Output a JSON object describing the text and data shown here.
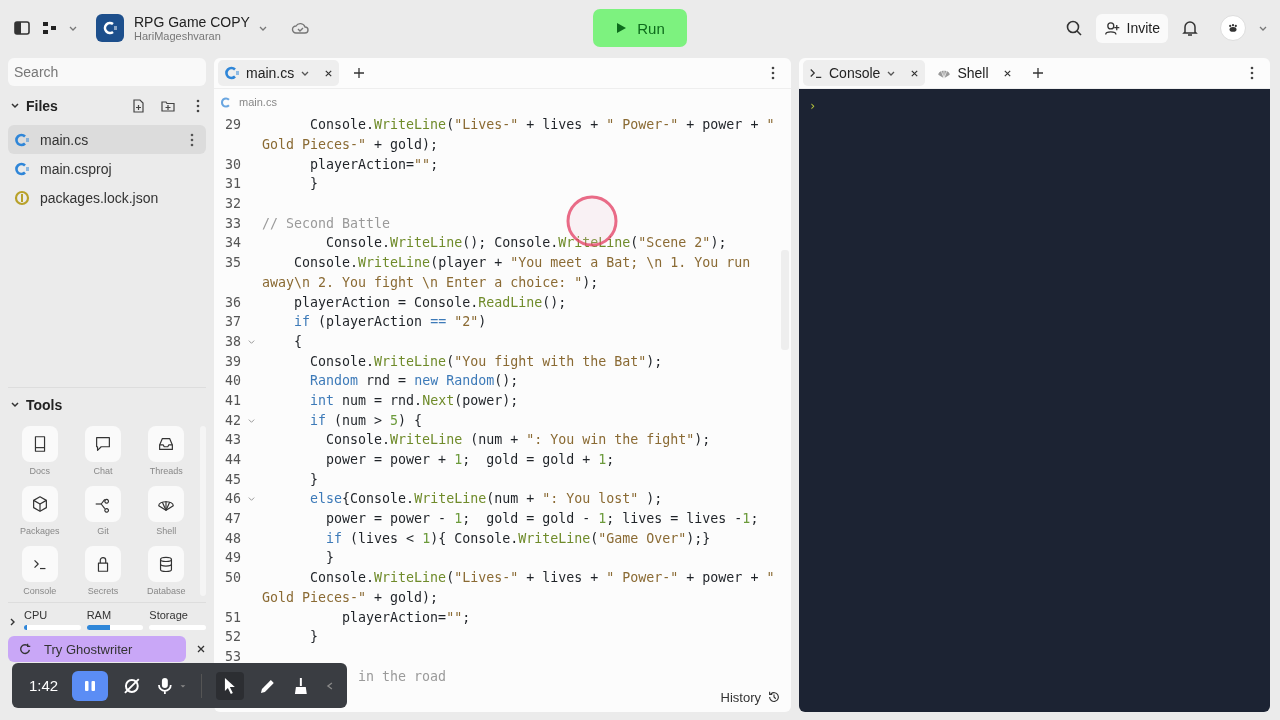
{
  "topbar": {
    "project": "RPG Game COPY",
    "owner": "HariMageshvaran",
    "run": "Run",
    "invite": "Invite"
  },
  "sidebar": {
    "search_placeholder": "Search",
    "files_title": "Files",
    "files": [
      {
        "name": "main.cs",
        "kind": "csharp",
        "selected": true
      },
      {
        "name": "main.csproj",
        "kind": "csharp",
        "selected": false
      },
      {
        "name": "packages.lock.json",
        "kind": "json",
        "selected": false
      }
    ],
    "tools_title": "Tools",
    "tools": [
      {
        "label": "Docs",
        "kind": "docs"
      },
      {
        "label": "Chat",
        "kind": "chat"
      },
      {
        "label": "Threads",
        "kind": "threads"
      },
      {
        "label": "Packages",
        "kind": "packages"
      },
      {
        "label": "Git",
        "kind": "git"
      },
      {
        "label": "Shell",
        "kind": "shell"
      },
      {
        "label": "Console",
        "kind": "console"
      },
      {
        "label": "Secrets",
        "kind": "secrets"
      },
      {
        "label": "Database",
        "kind": "database"
      }
    ],
    "resources": [
      {
        "label": "CPU",
        "level": 0.06
      },
      {
        "label": "RAM",
        "level": 0.42
      },
      {
        "label": "Storage"
      }
    ],
    "ghostwriter": "Try Ghostwriter"
  },
  "editor": {
    "tabs": [
      {
        "label": "main.cs",
        "selected": true
      }
    ],
    "breadcrumb": "main.cs",
    "history": "History",
    "lines": [
      {
        "number": "29",
        "foldable": false,
        "tokens": [
          {
            "kind": "plain",
            "text": "      Console."
          },
          {
            "kind": "method",
            "text": "WriteLine"
          },
          {
            "kind": "plain",
            "text": "("
          },
          {
            "kind": "string",
            "text": "\"Lives-\""
          },
          {
            "kind": "plain",
            "text": " + lives + "
          },
          {
            "kind": "string",
            "text": "\" Power-\""
          },
          {
            "kind": "plain",
            "text": " + power + "
          },
          {
            "kind": "string",
            "text": "\""
          }
        ]
      },
      {
        "foldable": false,
        "tokens": [
          {
            "kind": "string",
            "text": "Gold Pieces-\""
          },
          {
            "kind": "plain",
            "text": " + gold);"
          }
        ]
      },
      {
        "number": "30",
        "foldable": false,
        "tokens": [
          {
            "kind": "plain",
            "text": "      playerAction="
          },
          {
            "kind": "string",
            "text": "\"\""
          },
          {
            "kind": "plain",
            "text": ";"
          }
        ]
      },
      {
        "number": "31",
        "foldable": false,
        "tokens": [
          {
            "kind": "plain",
            "text": "      }"
          }
        ]
      },
      {
        "number": "32",
        "foldable": false
      },
      {
        "number": "33",
        "foldable": false,
        "tokens": [
          {
            "kind": "comment",
            "text": "// Second Battle"
          }
        ]
      },
      {
        "number": "34",
        "foldable": false,
        "tokens": [
          {
            "kind": "plain",
            "text": "        Console."
          },
          {
            "kind": "method",
            "text": "WriteLine"
          },
          {
            "kind": "plain",
            "text": "(); Console."
          },
          {
            "kind": "method",
            "text": "WriteLine"
          },
          {
            "kind": "plain",
            "text": "("
          },
          {
            "kind": "string",
            "text": "\"Scene 2\""
          },
          {
            "kind": "plain",
            "text": ");"
          }
        ]
      },
      {
        "number": "35",
        "foldable": false,
        "tokens": [
          {
            "kind": "plain",
            "text": "    Console."
          },
          {
            "kind": "method",
            "text": "WriteLine"
          },
          {
            "kind": "plain",
            "text": "(player + "
          },
          {
            "kind": "string",
            "text": "\"You meet a Bat; \\n 1. You run"
          }
        ]
      },
      {
        "foldable": false,
        "tokens": [
          {
            "kind": "string",
            "text": "away\\n 2. You fight \\n Enter a choice: \""
          },
          {
            "kind": "plain",
            "text": ");"
          }
        ]
      },
      {
        "number": "36",
        "foldable": false,
        "tokens": [
          {
            "kind": "plain",
            "text": "    playerAction = Console."
          },
          {
            "kind": "method",
            "text": "ReadLine"
          },
          {
            "kind": "plain",
            "text": "();"
          }
        ]
      },
      {
        "number": "37",
        "foldable": false,
        "tokens": [
          {
            "kind": "keyword",
            "text": "    if"
          },
          {
            "kind": "plain",
            "text": " (playerAction "
          },
          {
            "kind": "keyword",
            "text": "== "
          },
          {
            "kind": "string",
            "text": "\"2\""
          },
          {
            "kind": "plain",
            "text": ")"
          }
        ]
      },
      {
        "number": "38",
        "foldable": true,
        "tokens": [
          {
            "kind": "plain",
            "text": "    {"
          }
        ]
      },
      {
        "number": "39",
        "foldable": false,
        "tokens": [
          {
            "kind": "plain",
            "text": "      Console."
          },
          {
            "kind": "method",
            "text": "WriteLine"
          },
          {
            "kind": "plain",
            "text": "("
          },
          {
            "kind": "string",
            "text": "\"You fight with the Bat\""
          },
          {
            "kind": "plain",
            "text": ");"
          }
        ]
      },
      {
        "number": "40",
        "foldable": false,
        "tokens": [
          {
            "kind": "type",
            "text": "      Random"
          },
          {
            "kind": "plain",
            "text": " rnd = "
          },
          {
            "kind": "keyword",
            "text": "new "
          },
          {
            "kind": "type",
            "text": "Random"
          },
          {
            "kind": "plain",
            "text": "();"
          }
        ]
      },
      {
        "number": "41",
        "foldable": false,
        "tokens": [
          {
            "kind": "keyword",
            "text": "      int"
          },
          {
            "kind": "plain",
            "text": " num = rnd."
          },
          {
            "kind": "method",
            "text": "Next"
          },
          {
            "kind": "plain",
            "text": "(power);"
          }
        ]
      },
      {
        "number": "42",
        "foldable": true,
        "tokens": [
          {
            "kind": "keyword",
            "text": "      if"
          },
          {
            "kind": "plain",
            "text": " (num > "
          },
          {
            "kind": "number",
            "text": "5"
          },
          {
            "kind": "plain",
            "text": ") {"
          }
        ]
      },
      {
        "number": "43",
        "foldable": false,
        "tokens": [
          {
            "kind": "plain",
            "text": "        Console."
          },
          {
            "kind": "method",
            "text": "WriteLine"
          },
          {
            "kind": "plain",
            "text": " (num + "
          },
          {
            "kind": "string",
            "text": "\": You win the fight\""
          },
          {
            "kind": "plain",
            "text": ");"
          }
        ]
      },
      {
        "number": "44",
        "foldable": false,
        "tokens": [
          {
            "kind": "plain",
            "text": "        power = power + "
          },
          {
            "kind": "number",
            "text": "1"
          },
          {
            "kind": "plain",
            "text": ";  gold = gold + "
          },
          {
            "kind": "number",
            "text": "1"
          },
          {
            "kind": "plain",
            "text": ";"
          }
        ]
      },
      {
        "number": "45",
        "foldable": false,
        "tokens": [
          {
            "kind": "plain",
            "text": "      }"
          }
        ]
      },
      {
        "number": "46",
        "foldable": true,
        "tokens": [
          {
            "kind": "keyword",
            "text": "      else"
          },
          {
            "kind": "plain",
            "text": "{Console."
          },
          {
            "kind": "method",
            "text": "WriteLine"
          },
          {
            "kind": "plain",
            "text": "(num + "
          },
          {
            "kind": "string",
            "text": "\": You lost\""
          },
          {
            "kind": "plain",
            "text": " );"
          }
        ]
      },
      {
        "number": "47",
        "foldable": false,
        "tokens": [
          {
            "kind": "plain",
            "text": "        power = power - "
          },
          {
            "kind": "number",
            "text": "1"
          },
          {
            "kind": "plain",
            "text": ";  gold = gold - "
          },
          {
            "kind": "number",
            "text": "1"
          },
          {
            "kind": "plain",
            "text": "; lives = lives -"
          },
          {
            "kind": "number",
            "text": "1"
          },
          {
            "kind": "plain",
            "text": ";"
          }
        ]
      },
      {
        "number": "48",
        "foldable": false,
        "tokens": [
          {
            "kind": "keyword",
            "text": "        if"
          },
          {
            "kind": "plain",
            "text": " (lives < "
          },
          {
            "kind": "number",
            "text": "1"
          },
          {
            "kind": "plain",
            "text": "){ Console."
          },
          {
            "kind": "method",
            "text": "WriteLine"
          },
          {
            "kind": "plain",
            "text": "("
          },
          {
            "kind": "string",
            "text": "\"Game Over\""
          },
          {
            "kind": "plain",
            "text": ");}"
          }
        ]
      },
      {
        "number": "49",
        "foldable": false,
        "tokens": [
          {
            "kind": "plain",
            "text": "        }"
          }
        ]
      },
      {
        "number": "50",
        "foldable": false,
        "tokens": [
          {
            "kind": "plain",
            "text": "      Console."
          },
          {
            "kind": "method",
            "text": "WriteLine"
          },
          {
            "kind": "plain",
            "text": "("
          },
          {
            "kind": "string",
            "text": "\"Lives-\""
          },
          {
            "kind": "plain",
            "text": " + lives + "
          },
          {
            "kind": "string",
            "text": "\" Power-\""
          },
          {
            "kind": "plain",
            "text": " + power + "
          },
          {
            "kind": "string",
            "text": "\""
          }
        ]
      },
      {
        "foldable": false,
        "tokens": [
          {
            "kind": "string",
            "text": "Gold Pieces-\""
          },
          {
            "kind": "plain",
            "text": " + gold);"
          }
        ]
      },
      {
        "number": "51",
        "foldable": false,
        "tokens": [
          {
            "kind": "plain",
            "text": "          playerAction="
          },
          {
            "kind": "string",
            "text": "\"\""
          },
          {
            "kind": "plain",
            "text": ";"
          }
        ]
      },
      {
        "number": "52",
        "foldable": false,
        "tokens": [
          {
            "kind": "plain",
            "text": "      }"
          }
        ]
      },
      {
        "number": "53",
        "foldable": false
      },
      {
        "tokens": [
          {
            "kind": "comment",
            "text": "            in the road"
          }
        ]
      }
    ]
  },
  "console": {
    "tabs": [
      {
        "label": "Console",
        "kind": "console",
        "selected": true
      },
      {
        "label": "Shell",
        "kind": "shell",
        "selected": false
      }
    ],
    "prompt": "›"
  },
  "recorder": {
    "time": "1:42"
  }
}
